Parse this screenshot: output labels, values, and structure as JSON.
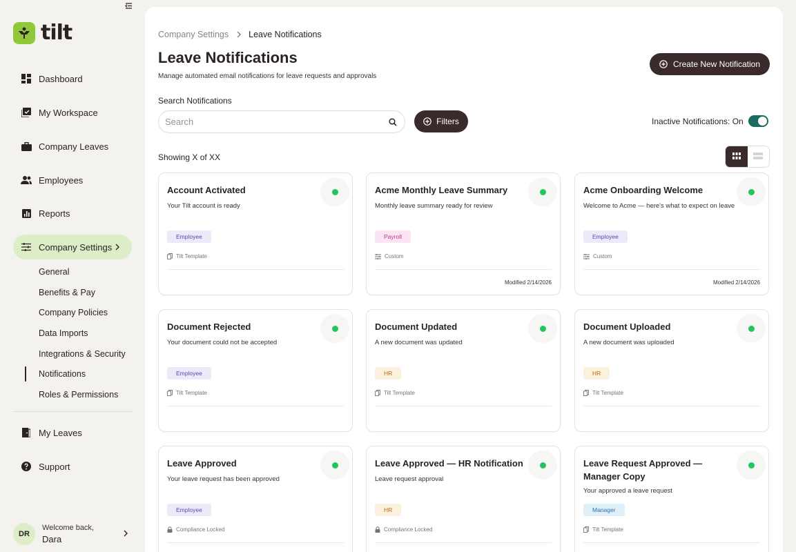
{
  "brand": {
    "name": "tilt",
    "accent": "#8fc93a"
  },
  "sidebar": {
    "nav": [
      {
        "label": "Dashboard",
        "icon": "dashboard-icon"
      },
      {
        "label": "My Workspace",
        "icon": "workspace-icon"
      },
      {
        "label": "Company Leaves",
        "icon": "briefcase-icon"
      },
      {
        "label": "Employees",
        "icon": "people-icon"
      },
      {
        "label": "Reports",
        "icon": "chart-icon"
      },
      {
        "label": "Company Settings",
        "icon": "sliders-icon",
        "active": true
      }
    ],
    "sub": [
      "General",
      "Benefits & Pay",
      "Company Policies",
      "Data Imports",
      "Integrations & Security",
      "Notifications",
      "Roles & Permissions"
    ],
    "bottom_nav": [
      {
        "label": "My Leaves",
        "icon": "door-icon"
      },
      {
        "label": "Support",
        "icon": "help-icon"
      }
    ],
    "user": {
      "initials": "DR",
      "welcome": "Welcome back,",
      "name": "Dara"
    }
  },
  "header": {
    "breadcrumb_parent": "Company Settings",
    "breadcrumb_current": "Leave Notifications",
    "title": "Leave Notifications",
    "subtitle": "Manage automated email notifications for leave requests and approvals",
    "create_label": "Create New Notification"
  },
  "search": {
    "label": "Search Notifications",
    "placeholder": "Search"
  },
  "filters_label": "Filters",
  "inactive_toggle": {
    "label": "Inactive Notifications: On",
    "on": true
  },
  "showing": "Showing X of XX",
  "cards": [
    {
      "title": "Account Activated",
      "desc": "Your Tilt account is ready",
      "tag": "Employee",
      "source": "Tilt Template",
      "source_icon": "copy-icon",
      "modified": ""
    },
    {
      "title": "Acme Monthly Leave Summary",
      "desc": "Monthly leave summary ready for review",
      "tag": "Payroll",
      "source": "Custom",
      "source_icon": "custom-icon",
      "modified": "Modified 2/14/2026"
    },
    {
      "title": "Acme Onboarding Welcome",
      "desc": "Welcome to Acme — here's what to expect on leave",
      "tag": "Employee",
      "source": "Custom",
      "source_icon": "custom-icon",
      "modified": "Modified 2/14/2026"
    },
    {
      "title": "Document Rejected",
      "desc": "Your document could not be accepted",
      "tag": "Employee",
      "source": "Tilt Template",
      "source_icon": "copy-icon",
      "modified": ""
    },
    {
      "title": "Document Updated",
      "desc": "A new document was updated",
      "tag": "HR",
      "source": "Tilt Template",
      "source_icon": "copy-icon",
      "modified": ""
    },
    {
      "title": "Document Uploaded",
      "desc": "A new document was uploaded",
      "tag": "HR",
      "source": "Tilt Template",
      "source_icon": "copy-icon",
      "modified": ""
    },
    {
      "title": "Leave Approved",
      "desc": "Your leave request has been approved",
      "tag": "Employee",
      "source": "Compliance Locked",
      "source_icon": "lock-icon",
      "modified": ""
    },
    {
      "title": "Leave Approved — HR Notification",
      "desc": "Leave request approval",
      "tag": "HR",
      "source": "Compliance Locked",
      "source_icon": "lock-icon",
      "modified": ""
    },
    {
      "title": "Leave Request Approved — Manager Copy",
      "desc": "Your approved a leave request",
      "tag": "Manager",
      "source": "Tilt Template",
      "source_icon": "copy-icon",
      "modified": ""
    }
  ],
  "colors": {
    "dark": "#3b2a2b",
    "active_status": "#22c55e",
    "toggle_on": "#1b6b63"
  }
}
